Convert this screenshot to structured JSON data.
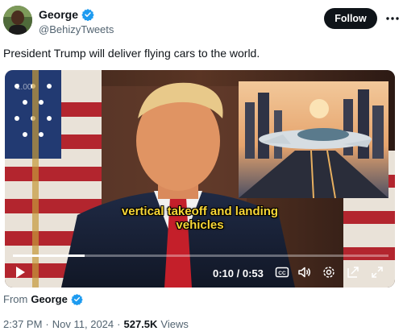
{
  "author": {
    "display_name": "George",
    "handle": "@BehizyTweets",
    "verified_icon": "verified-badge-icon"
  },
  "follow_label": "Follow",
  "tweet_text": "President Trump will deliver flying cars to the world.",
  "video": {
    "overlay_corner_text": "1.00",
    "caption_line1": "vertical takeoff and landing",
    "caption_line2": "vehicles",
    "time_display": "0:10 / 0:53",
    "progress": 0.19,
    "caption_color": "#f7d637",
    "controls": [
      "play-icon",
      "captions-icon",
      "volume-icon",
      "settings-icon",
      "popout-icon",
      "fullscreen-icon"
    ]
  },
  "from": {
    "prefix": "From",
    "name": "George"
  },
  "meta": {
    "time": "2:37 PM",
    "separator1": "·",
    "date": "Nov 11, 2024",
    "separator2": "·",
    "views_count": "527.5K",
    "views_label": "Views"
  },
  "colors": {
    "verified_blue": "#1d9bf0",
    "text_primary": "#0f1419",
    "text_secondary": "#536471"
  }
}
